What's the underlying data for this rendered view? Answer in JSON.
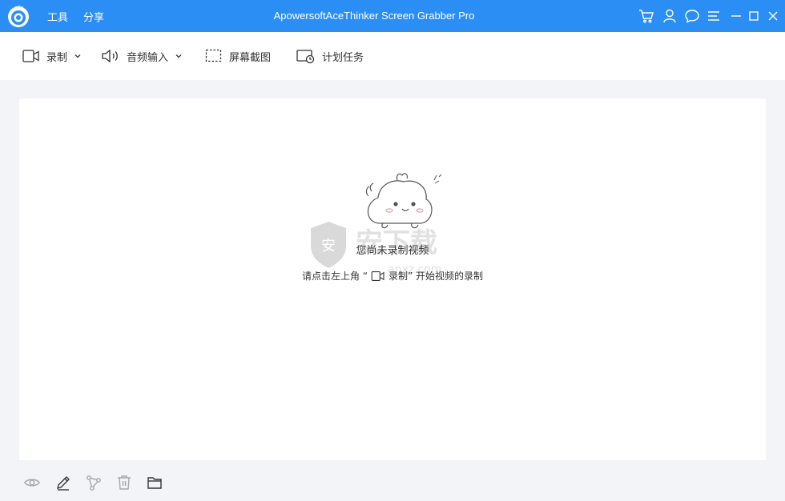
{
  "titlebar": {
    "title": "ApowersoftAceThinker Screen Grabber Pro",
    "menu": [
      "工具",
      "分享"
    ],
    "icons": [
      "cart-icon",
      "user-icon",
      "chat-icon",
      "menu-icon",
      "minimize-icon",
      "maximize-icon",
      "close-icon"
    ],
    "background": "#2b8ef5"
  },
  "toolbar": {
    "record_label": "录制",
    "audio_label": "音频输入",
    "screenshot_label": "屏幕截图",
    "schedule_label": "计划任务"
  },
  "empty_state": {
    "title": "您尚未录制视频",
    "hint_prefix": "请点击左上角 “",
    "hint_record": "录制",
    "hint_suffix": "” 开始视频的录制",
    "watermark_text": "安下载",
    "watermark_sub": "anxz.com"
  },
  "bottom_icons": [
    "eye-icon",
    "pencil-icon",
    "share-icon",
    "trash-icon",
    "folder-icon"
  ]
}
